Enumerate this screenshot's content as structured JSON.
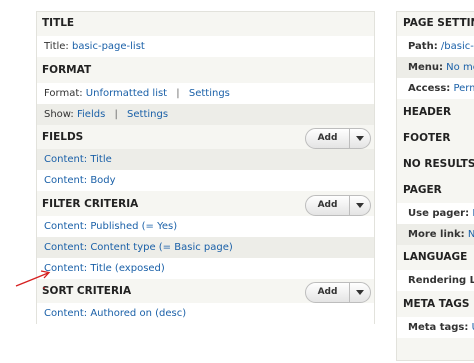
{
  "left": {
    "title_section": {
      "heading": "TITLE",
      "rows": [
        {
          "label": "Title:",
          "link": "basic-page-list"
        }
      ]
    },
    "format_section": {
      "heading": "FORMAT",
      "format_label": "Format:",
      "format_link": "Unformatted list",
      "separator": "|",
      "format_settings": "Settings",
      "show_label": "Show:",
      "show_link": "Fields",
      "show_settings": "Settings"
    },
    "fields_section": {
      "heading": "FIELDS",
      "add_label": "Add",
      "items": [
        "Content: Title",
        "Content: Body"
      ]
    },
    "filter_section": {
      "heading": "FILTER CRITERIA",
      "add_label": "Add",
      "items": [
        "Content: Published (= Yes)",
        "Content: Content type (= Basic page)",
        "Content: Title (exposed)"
      ]
    },
    "sort_section": {
      "heading": "SORT CRITERIA",
      "add_label": "Add",
      "items": [
        "Content: Authored on (desc)"
      ]
    }
  },
  "right": {
    "page_settings": {
      "heading": "PAGE SETTIN",
      "path_label": "Path:",
      "path_link": "/basic-",
      "menu_label": "Menu:",
      "menu_link": "No me",
      "access_label": "Access:",
      "access_link": "Perm"
    },
    "header": "HEADER",
    "footer": "FOOTER",
    "no_results": "NO RESULTS",
    "pager": {
      "heading": "PAGER",
      "use_pager_label": "Use pager:",
      "use_pager_link": "M",
      "more_link_label": "More link:",
      "more_link_link": "No"
    },
    "language": {
      "heading": "LANGUAGE",
      "rendering_label": "Rendering La"
    },
    "meta_tags": {
      "heading": "META TAGS",
      "label": "Meta tags:",
      "link": "U"
    }
  },
  "colors": {
    "link": "#1a60a8",
    "annotation_arrow": "#d62020"
  }
}
